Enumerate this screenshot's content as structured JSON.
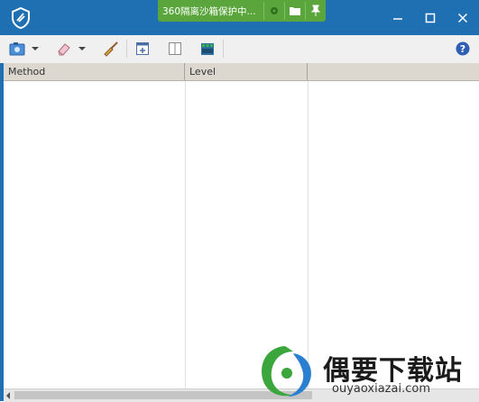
{
  "sandbox": {
    "text": "360隔离沙箱保护中..."
  },
  "columns": [
    "Method",
    "Level",
    ""
  ],
  "icons": {
    "app": "shield-icon",
    "sandbox": [
      "gear-icon",
      "folder-icon",
      "pin-icon"
    ],
    "window": [
      "minimize-icon",
      "maximize-icon",
      "close-icon"
    ],
    "toolbar": [
      "screenshot-icon",
      "eraser-icon",
      "broom-icon",
      "add-icon",
      "columns-icon",
      "grid-icon",
      "help-icon"
    ]
  },
  "colors": {
    "titlebar": "#1f6fb3",
    "sandbox": "#5aa63c",
    "accent": "#3a7bd5"
  },
  "watermark": {
    "title": "偶要下载站",
    "url": "ouyaoxiazai.com"
  }
}
